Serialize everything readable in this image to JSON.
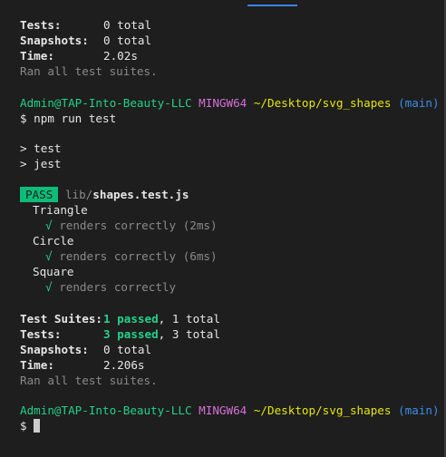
{
  "summary1": {
    "tests_label": "Tests:",
    "tests_value": "0 total",
    "snapshots_label": "Snapshots:",
    "snapshots_value": "0 total",
    "time_label": "Time:",
    "time_value": "2.02s",
    "ran_all": "Ran all test suites."
  },
  "prompt1": {
    "user_host": "Admin@TAP-Into-Beauty-LLC",
    "env": "MINGW64",
    "path": "~/Desktop/svg_shapes",
    "branch": "(main)"
  },
  "command": "$ npm run test",
  "script_lines": [
    "> test",
    "> jest"
  ],
  "result": {
    "badge": "PASS",
    "file_dir": "lib/",
    "file_name": "shapes.test.js",
    "groups": [
      {
        "name": "Triangle",
        "check": "√",
        "test": "renders correctly",
        "time": "(2ms)"
      },
      {
        "name": "Circle",
        "check": "√",
        "test": "renders correctly",
        "time": "(6ms)"
      },
      {
        "name": "Square",
        "check": "√",
        "test": "renders correctly",
        "time": ""
      }
    ]
  },
  "summary2": {
    "suites_label": "Test Suites:",
    "suites_passed": "1 passed",
    "suites_total": ", 1 total",
    "tests_label": "Tests:",
    "tests_passed": "3 passed",
    "tests_total": ", 3 total",
    "snapshots_label": "Snapshots:",
    "snapshots_value": "0 total",
    "time_label": "Time:",
    "time_value": "2.206s",
    "ran_all": "Ran all test suites."
  },
  "prompt2": {
    "user_host": "Admin@TAP-Into-Beauty-LLC",
    "env": "MINGW64",
    "path": "~/Desktop/svg_shapes",
    "branch": "(main)"
  },
  "input_prompt": "$ ",
  "colors": {
    "background": "#1e1e1e",
    "pass_badge": "#0dbc79",
    "green": "#23d18b",
    "magenta": "#d670d6",
    "yellow": "#e5e510",
    "blue": "#3b8eea"
  }
}
